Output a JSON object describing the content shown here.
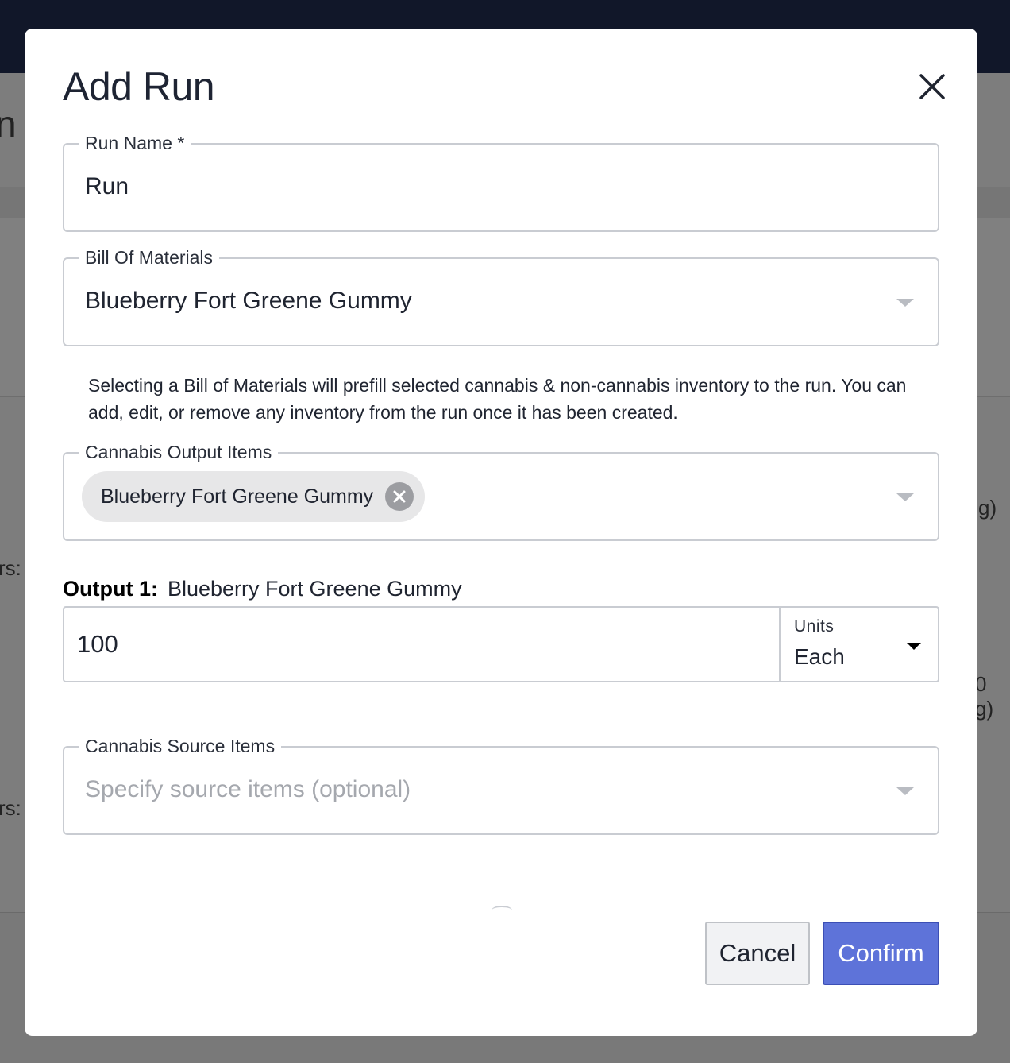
{
  "background": {
    "heading_fragment": "n T",
    "label_fragment_1": "rs:",
    "label_fragment_2": "rs:",
    "value_fragment_1": "g)",
    "value_fragment_2": "0 g)"
  },
  "modal": {
    "title": "Add Run",
    "run_name": {
      "label": "Run Name *",
      "value": "Run"
    },
    "bill_of_materials": {
      "label": "Bill Of Materials",
      "selected": "Blueberry Fort Greene Gummy"
    },
    "helper_text": "Selecting a Bill of Materials will prefill selected cannabis & non-cannabis inventory to the run. You can add, edit, or remove any inventory from the run once it has been created.",
    "cannabis_output_items": {
      "label": "Cannabis Output Items",
      "chips": [
        "Blueberry Fort Greene Gummy"
      ]
    },
    "output": {
      "prefix": "Output 1:",
      "name": "Blueberry Fort Greene Gummy",
      "quantity": "100",
      "units_label": "Units",
      "units_value": "Each"
    },
    "cannabis_source_items": {
      "label": "Cannabis Source Items",
      "placeholder": "Specify source items (optional)"
    },
    "buttons": {
      "cancel": "Cancel",
      "confirm": "Confirm"
    }
  },
  "colors": {
    "primary": "#5e73d9",
    "topbar": "#111729",
    "overlay": "#7f7f7f"
  }
}
